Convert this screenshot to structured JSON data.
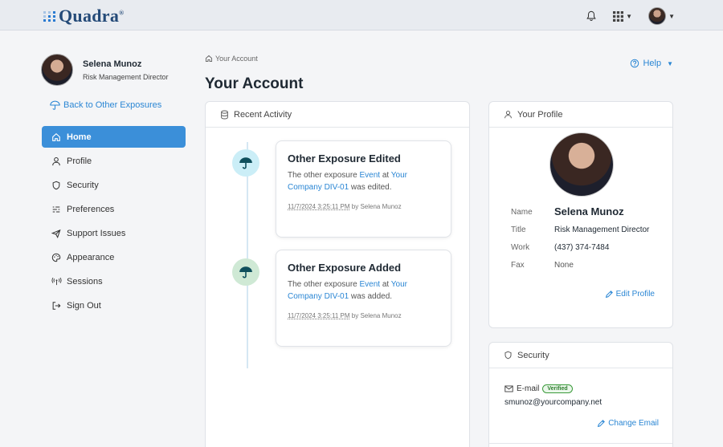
{
  "header": {
    "logo_text": "Quadra",
    "logo_mark": "®",
    "bell_icon": "bell-icon",
    "apps_icon": "apps-grid-icon"
  },
  "sidebar": {
    "user_name": "Selena Munoz",
    "user_role": "Risk Management Director",
    "back_link": "Back to Other Exposures",
    "items": [
      {
        "label": "Home",
        "icon": "home-icon",
        "active": true
      },
      {
        "label": "Profile",
        "icon": "user-icon"
      },
      {
        "label": "Security",
        "icon": "shield-icon"
      },
      {
        "label": "Preferences",
        "icon": "list-settings-icon"
      },
      {
        "label": "Support Issues",
        "icon": "send-icon"
      },
      {
        "label": "Appearance",
        "icon": "palette-icon"
      },
      {
        "label": "Sessions",
        "icon": "broadcast-icon"
      },
      {
        "label": "Sign Out",
        "icon": "sign-out-icon"
      }
    ]
  },
  "main": {
    "breadcrumb": "Your Account",
    "title": "Your Account",
    "help_label": "Help"
  },
  "activity": {
    "header": "Recent Activity",
    "events": [
      {
        "title": "Other Exposure Edited",
        "text_1": "The other exposure ",
        "link_1": "Event",
        "text_2": " at ",
        "link_2": "Your Company DIV-01",
        "text_3": " was edited.",
        "timestamp": "11/7/2024 3:25:11 PM",
        "by": " by Selena Munoz"
      },
      {
        "title": "Other Exposure Added",
        "text_1": "The other exposure ",
        "link_1": "Event",
        "text_2": " at ",
        "link_2": "Your Company DIV-01",
        "text_3": " was added.",
        "timestamp": "11/7/2024 3:25:11 PM",
        "by": " by Selena Munoz"
      }
    ]
  },
  "profile": {
    "header": "Your Profile",
    "name_label": "Name",
    "name": "Selena Munoz",
    "title_label": "Title",
    "title": "Risk Management Director",
    "work_label": "Work",
    "work": "(437) 374-7484",
    "fax_label": "Fax",
    "fax": "None",
    "edit_label": "Edit Profile"
  },
  "security": {
    "header": "Security",
    "email_label": "E-mail",
    "verified_badge": "Verified",
    "email": "smunoz@yourcompany.net",
    "change_label": "Change Email"
  },
  "colors": {
    "accent": "#3b8fd9",
    "link": "#2a86d4",
    "verified": "#3a9a3a"
  }
}
